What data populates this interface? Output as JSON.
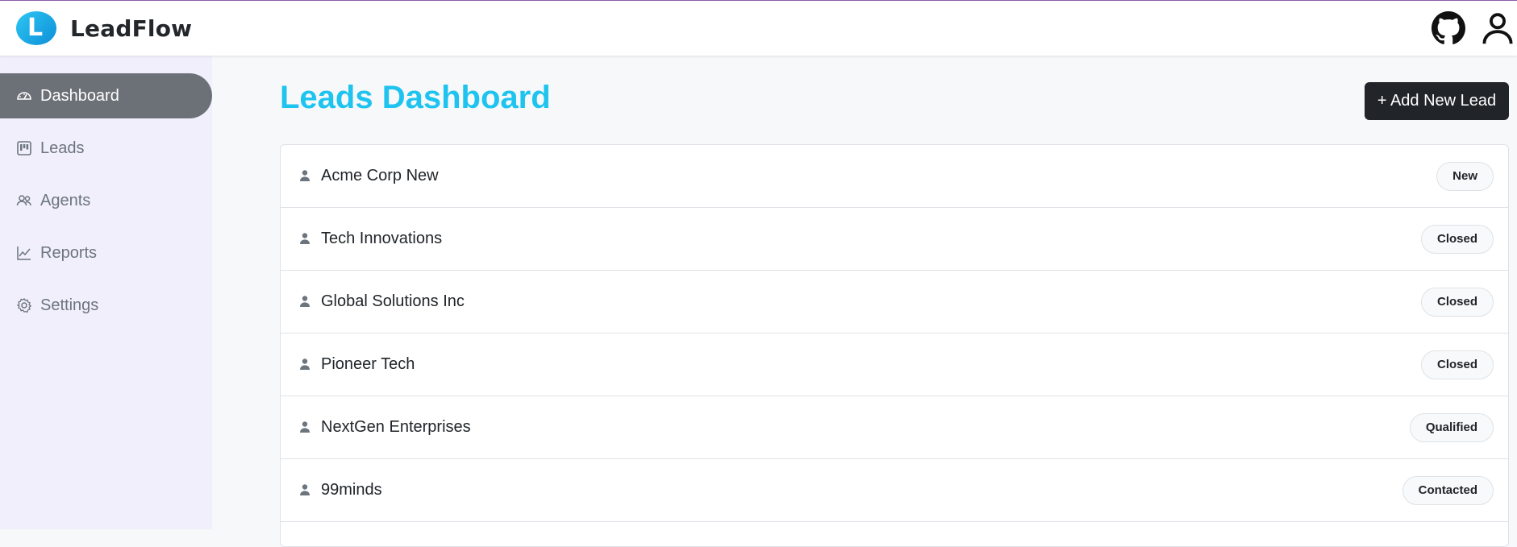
{
  "app": {
    "name": "LeadFlow",
    "logo_letter": "L"
  },
  "header": {
    "github_icon": "github-icon",
    "profile_icon": "user-icon"
  },
  "sidebar": {
    "items": [
      {
        "label": "Dashboard",
        "icon": "gauge-icon",
        "active": true
      },
      {
        "label": "Leads",
        "icon": "kanban-icon",
        "active": false
      },
      {
        "label": "Agents",
        "icon": "people-icon",
        "active": false
      },
      {
        "label": "Reports",
        "icon": "graph-icon",
        "active": false
      },
      {
        "label": "Settings",
        "icon": "gear-icon",
        "active": false
      }
    ]
  },
  "main": {
    "title": "Leads Dashboard",
    "add_button_label": "+ Add New Lead",
    "leads": [
      {
        "name": "Acme Corp New",
        "status": "New"
      },
      {
        "name": "Tech Innovations",
        "status": "Closed"
      },
      {
        "name": "Global Solutions Inc",
        "status": "Closed"
      },
      {
        "name": "Pioneer Tech",
        "status": "Closed"
      },
      {
        "name": "NextGen Enterprises",
        "status": "Qualified"
      },
      {
        "name": "99minds",
        "status": "Contacted"
      }
    ]
  },
  "colors": {
    "accent": "#1ec4ef",
    "sidebar_bg": "#f1effc",
    "active_nav_bg": "#6c7178",
    "button_bg": "#212529"
  }
}
